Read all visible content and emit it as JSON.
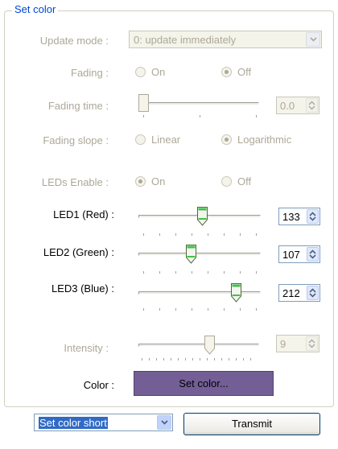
{
  "group": {
    "title": "Set color"
  },
  "update_mode": {
    "label": "Update mode :",
    "value": "0: update immediately"
  },
  "fading": {
    "label": "Fading :",
    "on_label": "On",
    "off_label": "Off",
    "selected": "Off"
  },
  "fading_time": {
    "label": "Fading time :",
    "value": "0.0",
    "slider_position": 0.0
  },
  "fading_slope": {
    "label": "Fading slope :",
    "linear_label": "Linear",
    "log_label": "Logarithmic",
    "selected": "Logarithmic"
  },
  "leds_enable": {
    "label": "LEDs Enable :",
    "on_label": "On",
    "off_label": "Off",
    "selected": "On"
  },
  "led1": {
    "label": "LED1 (Red) :",
    "value": "133",
    "level": 0.52
  },
  "led2": {
    "label": "LED2 (Green) :",
    "value": "107",
    "level": 0.42
  },
  "led3": {
    "label": "LED3 (Blue) :",
    "value": "212",
    "level": 0.83
  },
  "intensity": {
    "label": "Intensity :",
    "value": "9",
    "level": 0.6
  },
  "color": {
    "label": "Color :",
    "button_label": "Set color...",
    "swatch": "#735f96"
  },
  "command": {
    "value": "Set color short"
  },
  "transmit": {
    "label": "Transmit"
  },
  "colors": {
    "accent": "#0046d5",
    "disabled_text": "#aca899",
    "selection": "#316ac5",
    "thumb_green": "#3ec24a"
  }
}
